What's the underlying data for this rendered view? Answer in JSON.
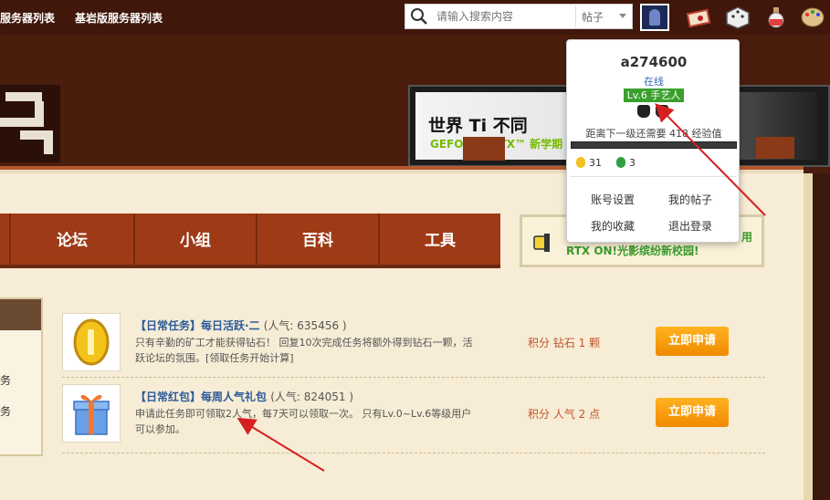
{
  "topbar": {
    "links": [
      "服务器列表",
      "基岩版服务器列表"
    ],
    "search": {
      "placeholder": "请输入搜索内容",
      "type_selected": "帖子"
    },
    "icons": [
      "search-icon",
      "avatar",
      "mail-icon",
      "dice-icon",
      "potion-icon",
      "palette-icon"
    ]
  },
  "banner": {
    "title": "世界 Ti 不同",
    "subtitle": "GEFORCE RTX™ 新学期"
  },
  "nav": {
    "items": [
      "论坛",
      "小组",
      "百科",
      "工具"
    ]
  },
  "notice": {
    "text": "RTX ON!光影缤纷新校园!",
    "text_tail": "用"
  },
  "left_panel": {
    "items": [
      "务",
      "务"
    ]
  },
  "tasks": [
    {
      "title": "【日常任务】每日活跃·二",
      "popularity": "(人气: 635456 )",
      "description": "只有辛勤的矿工才能获得钻石！ 回复10次完成任务将额外得到钻石一颗，活跃论坛的氛围。[领取任务开始计算]",
      "reward": "积分 钻石 1 颗",
      "button": "立即申请",
      "icon": "gold-coin-icon"
    },
    {
      "title": "【日常红包】每周人气礼包",
      "popularity": "(人气: 824051 )",
      "description": "申请此任务即可领取2人气，每7天可以领取一次。 只有Lv.0~Lv.6等级用户可以参加。",
      "reward": "积分 人气 2 点",
      "button": "立即申请",
      "icon": "gift-box-icon"
    }
  ],
  "user_popup": {
    "username": "a274600",
    "status": "在线",
    "level": "Lv.6 手艺人",
    "exp_text": "距离下一级还需要 418 经验值",
    "exp_progress": 0.0,
    "gold": "31",
    "emerald": "3",
    "links": [
      "账号设置",
      "我的帖子",
      "我的收藏",
      "退出登录"
    ]
  },
  "colors": {
    "nav": "#9e3a16",
    "accent_button": "#f59a10",
    "level_badge": "#3aa02c",
    "link": "#2a5a9a",
    "annotation_arrow": "#d42020"
  }
}
